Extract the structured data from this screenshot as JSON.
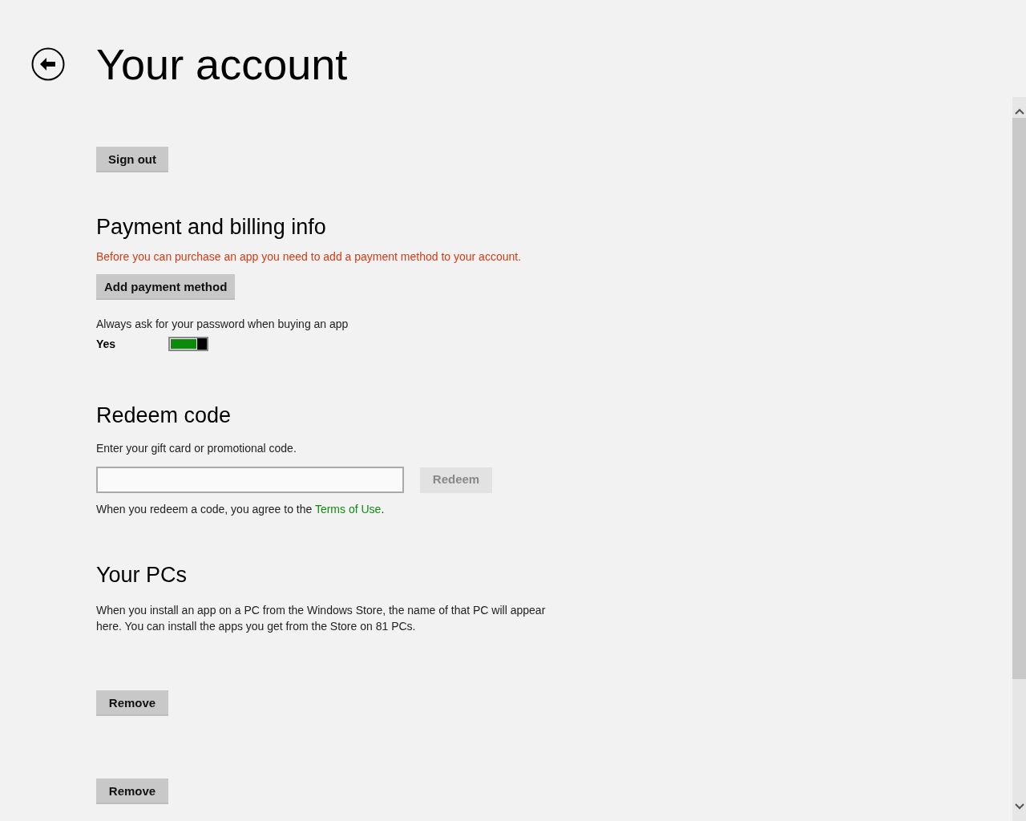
{
  "header": {
    "title": "Your account"
  },
  "sign_out_button": "Sign out",
  "payment": {
    "heading": "Payment and billing info",
    "warning": "Before you can purchase an app you need to add a payment method to your account.",
    "add_button": "Add payment method",
    "toggle_label": "Always ask for your password when buying an app",
    "toggle_state_text": "Yes",
    "toggle_on": true
  },
  "redeem": {
    "heading": "Redeem code",
    "instructions": "Enter your gift card or promotional code.",
    "redeem_button": {
      "label": "Redeem",
      "disabled": true
    },
    "terms_before": "When you redeem a code, you agree to the ",
    "terms_link": "Terms of Use",
    "terms_after": "."
  },
  "pcs": {
    "heading": "Your PCs",
    "description": "When you install an app on a PC from the Windows Store, the name of that PC will appear here. You can install the apps you get from the Store on 81 PCs.",
    "remove_buttons": [
      "Remove",
      "Remove"
    ]
  }
}
